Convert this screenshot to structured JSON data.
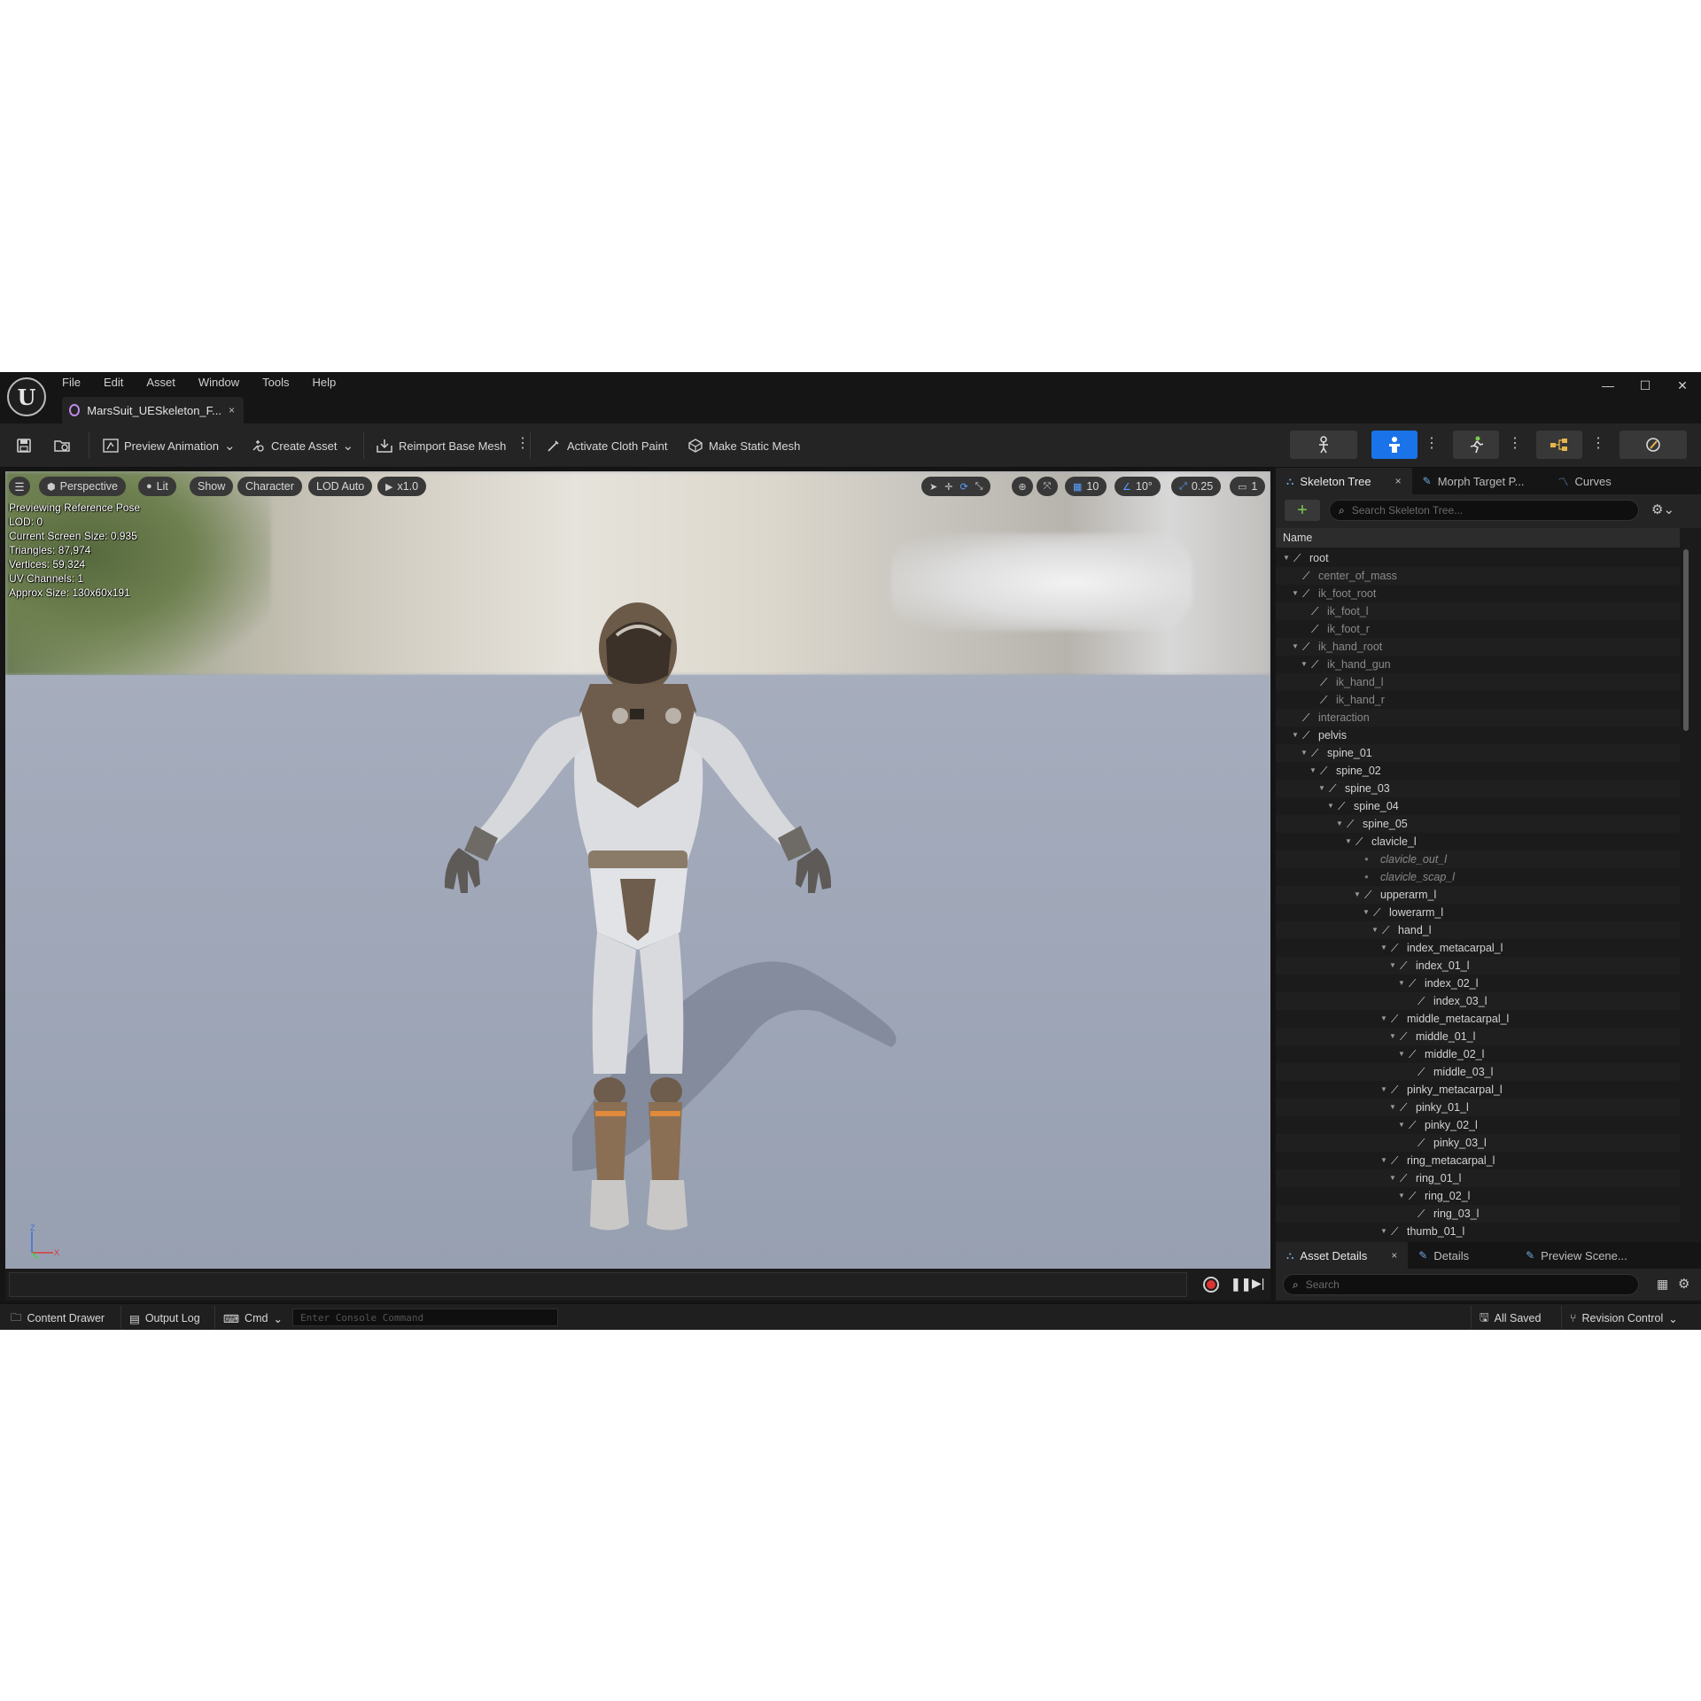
{
  "menu": [
    "File",
    "Edit",
    "Asset",
    "Window",
    "Tools",
    "Help"
  ],
  "document_tab": {
    "title": "MarsSuit_UESkeleton_F...",
    "close": "×"
  },
  "window_controls": {
    "minimize": "—",
    "maximize": "☐",
    "close": "✕"
  },
  "toolbar": {
    "preview_animation": "Preview Animation",
    "create_asset": "Create Asset",
    "reimport_base_mesh": "Reimport Base Mesh",
    "activate_cloth_paint": "Activate Cloth Paint",
    "make_static_mesh": "Make Static Mesh"
  },
  "viewport": {
    "perspective": "Perspective",
    "lit": "Lit",
    "show": "Show",
    "character": "Character",
    "lod": "LOD Auto",
    "play_speed": "x1.0",
    "grid_snap": "10",
    "rotation_snap": "10°",
    "scale_snap": "0.25",
    "camera_speed": "1",
    "stats": [
      "Previewing Reference Pose",
      "LOD: 0",
      "Current Screen Size: 0.935",
      "Triangles: 87,974",
      "Vertices: 59,324",
      "UV Channels: 1",
      "Approx Size: 130x60x191"
    ],
    "axis": {
      "z": "Z",
      "x": "X"
    }
  },
  "skeleton_panel": {
    "tabs": [
      "Skeleton Tree",
      "Morph Target P...",
      "Curves"
    ],
    "close": "×",
    "search_placeholder": "Search Skeleton Tree...",
    "column": "Name",
    "bones": [
      {
        "name": "root",
        "depth": 0,
        "expanded": true,
        "style": "bone"
      },
      {
        "name": "center_of_mass",
        "depth": 1,
        "expanded": false,
        "style": "dim"
      },
      {
        "name": "ik_foot_root",
        "depth": 1,
        "expanded": true,
        "style": "dim"
      },
      {
        "name": "ik_foot_l",
        "depth": 2,
        "expanded": false,
        "style": "dim"
      },
      {
        "name": "ik_foot_r",
        "depth": 2,
        "expanded": false,
        "style": "dim"
      },
      {
        "name": "ik_hand_root",
        "depth": 1,
        "expanded": true,
        "style": "dim"
      },
      {
        "name": "ik_hand_gun",
        "depth": 2,
        "expanded": true,
        "style": "dim"
      },
      {
        "name": "ik_hand_l",
        "depth": 3,
        "expanded": false,
        "style": "dim"
      },
      {
        "name": "ik_hand_r",
        "depth": 3,
        "expanded": false,
        "style": "dim"
      },
      {
        "name": "interaction",
        "depth": 1,
        "expanded": false,
        "style": "dim"
      },
      {
        "name": "pelvis",
        "depth": 1,
        "expanded": true,
        "style": "bone"
      },
      {
        "name": "spine_01",
        "depth": 2,
        "expanded": true,
        "style": "bone"
      },
      {
        "name": "spine_02",
        "depth": 3,
        "expanded": true,
        "style": "bone"
      },
      {
        "name": "spine_03",
        "depth": 4,
        "expanded": true,
        "style": "bone"
      },
      {
        "name": "spine_04",
        "depth": 5,
        "expanded": true,
        "style": "bone"
      },
      {
        "name": "spine_05",
        "depth": 6,
        "expanded": true,
        "style": "bone"
      },
      {
        "name": "clavicle_l",
        "depth": 7,
        "expanded": true,
        "style": "bone"
      },
      {
        "name": "clavicle_out_l",
        "depth": 8,
        "expanded": false,
        "style": "socket"
      },
      {
        "name": "clavicle_scap_l",
        "depth": 8,
        "expanded": false,
        "style": "socket"
      },
      {
        "name": "upperarm_l",
        "depth": 8,
        "expanded": true,
        "style": "bone"
      },
      {
        "name": "lowerarm_l",
        "depth": 9,
        "expanded": true,
        "style": "bone"
      },
      {
        "name": "hand_l",
        "depth": 10,
        "expanded": true,
        "style": "bone"
      },
      {
        "name": "index_metacarpal_l",
        "depth": 11,
        "expanded": true,
        "style": "bone"
      },
      {
        "name": "index_01_l",
        "depth": 12,
        "expanded": true,
        "style": "bone"
      },
      {
        "name": "index_02_l",
        "depth": 13,
        "expanded": true,
        "style": "bone"
      },
      {
        "name": "index_03_l",
        "depth": 14,
        "expanded": false,
        "style": "bone"
      },
      {
        "name": "middle_metacarpal_l",
        "depth": 11,
        "expanded": true,
        "style": "bone"
      },
      {
        "name": "middle_01_l",
        "depth": 12,
        "expanded": true,
        "style": "bone"
      },
      {
        "name": "middle_02_l",
        "depth": 13,
        "expanded": true,
        "style": "bone"
      },
      {
        "name": "middle_03_l",
        "depth": 14,
        "expanded": false,
        "style": "bone"
      },
      {
        "name": "pinky_metacarpal_l",
        "depth": 11,
        "expanded": true,
        "style": "bone"
      },
      {
        "name": "pinky_01_l",
        "depth": 12,
        "expanded": true,
        "style": "bone"
      },
      {
        "name": "pinky_02_l",
        "depth": 13,
        "expanded": true,
        "style": "bone"
      },
      {
        "name": "pinky_03_l",
        "depth": 14,
        "expanded": false,
        "style": "bone"
      },
      {
        "name": "ring_metacarpal_l",
        "depth": 11,
        "expanded": true,
        "style": "bone"
      },
      {
        "name": "ring_01_l",
        "depth": 12,
        "expanded": true,
        "style": "bone"
      },
      {
        "name": "ring_02_l",
        "depth": 13,
        "expanded": true,
        "style": "bone"
      },
      {
        "name": "ring_03_l",
        "depth": 14,
        "expanded": false,
        "style": "bone"
      },
      {
        "name": "thumb_01_l",
        "depth": 11,
        "expanded": true,
        "style": "bone"
      }
    ]
  },
  "details_panel": {
    "tabs": [
      "Asset Details",
      "Details",
      "Preview Scene..."
    ],
    "close": "×",
    "search_placeholder": "Search"
  },
  "statusbar": {
    "content_drawer": "Content Drawer",
    "output_log": "Output Log",
    "cmd": "Cmd",
    "console_placeholder": "Enter Console Command",
    "all_saved": "All Saved",
    "revision_control": "Revision Control"
  },
  "colors": {
    "accent": "#1a73e8",
    "panel_bg": "#1b1b1b",
    "toolbar_bg": "#242424",
    "titlebar_bg": "#151515",
    "add_green": "#7ccb4f"
  }
}
